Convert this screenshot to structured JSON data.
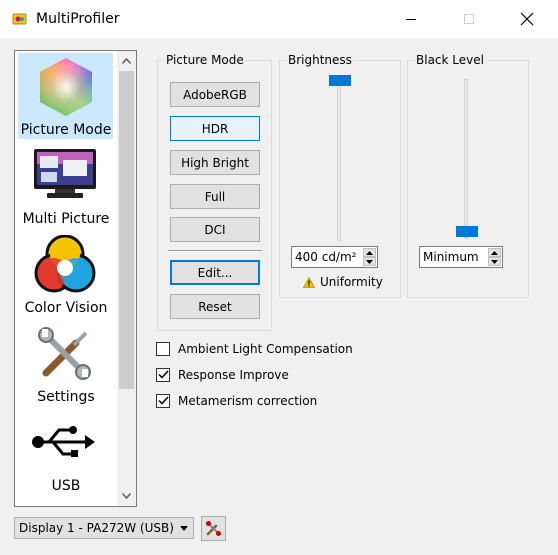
{
  "window": {
    "title": "MultiProfiler"
  },
  "sidebar": {
    "items": [
      {
        "label": "Picture Mode",
        "icon": "hexagon-color-icon",
        "selected": true
      },
      {
        "label": "Multi Picture",
        "icon": "monitor-icon",
        "selected": false
      },
      {
        "label": "Color Vision",
        "icon": "color-circles-icon",
        "selected": false
      },
      {
        "label": "Settings",
        "icon": "tools-icon",
        "selected": false
      },
      {
        "label": "USB",
        "icon": "usb-icon",
        "selected": false
      }
    ]
  },
  "picture_mode": {
    "title": "Picture Mode",
    "modes": [
      "AdobeRGB",
      "HDR",
      "High Bright",
      "Full",
      "DCI"
    ],
    "active_mode": "HDR",
    "edit_label": "Edit...",
    "reset_label": "Reset"
  },
  "brightness": {
    "title": "Brightness",
    "value": "400 cd/m²",
    "level": 1.0,
    "uniformity_label": "Uniformity"
  },
  "black_level": {
    "title": "Black Level",
    "value": "Minimum",
    "level": 0.0
  },
  "options": [
    {
      "label": "Ambient Light Compensation",
      "checked": false
    },
    {
      "label": "Response Improve",
      "checked": true
    },
    {
      "label": "Metamerism correction",
      "checked": true
    }
  ],
  "display_select": {
    "value": "Display 1 - PA272W (USB)"
  },
  "colors": {
    "accent": "#0078d7",
    "selected_bg": "#cce8ff"
  }
}
